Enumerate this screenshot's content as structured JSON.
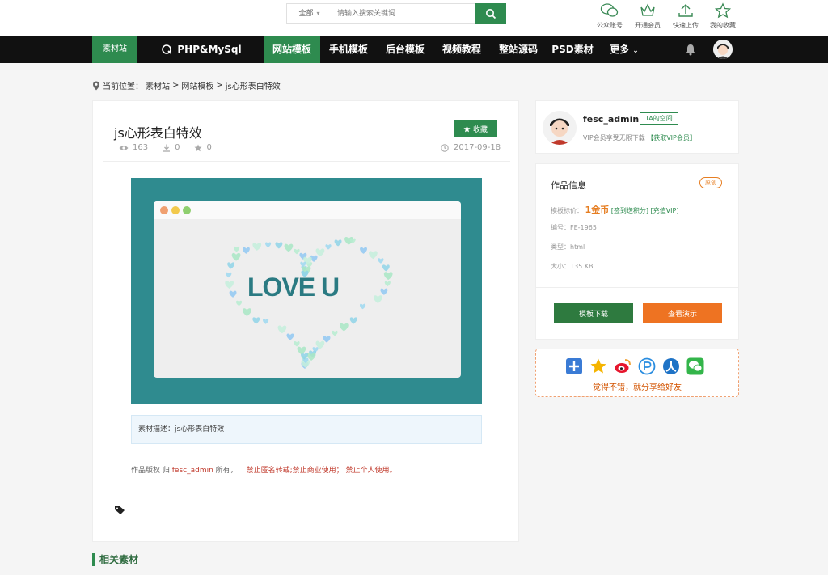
{
  "search": {
    "scope": "全部",
    "placeholder": "请输入搜索关键词"
  },
  "quick_links": [
    {
      "label": "公众账号",
      "icon": "wechat-icon"
    },
    {
      "label": "开通会员",
      "icon": "crown-icon"
    },
    {
      "label": "快速上传",
      "icon": "upload-icon"
    },
    {
      "label": "我的收藏",
      "icon": "star-icon"
    }
  ],
  "nav": {
    "logo": "素材站",
    "items": [
      {
        "label": "PHP&MySql"
      },
      {
        "label": "网站模板"
      },
      {
        "label": "手机模板"
      },
      {
        "label": "后台模板"
      },
      {
        "label": "视频教程"
      },
      {
        "label": "整站源码"
      },
      {
        "label": "PSD素材"
      },
      {
        "label": "更多"
      }
    ]
  },
  "breadcrumb": {
    "prefix": "当前位置：",
    "items": [
      "素材站",
      "网站模板",
      "js心形表白特效"
    ],
    "sep": ">"
  },
  "work": {
    "title": "js心形表白特效",
    "fav_label": "收藏",
    "views": "163",
    "downloads": "0",
    "stars": "0",
    "date": "2017-09-18",
    "preview_text": "LOVE U",
    "desc_label": "素材描述：",
    "desc": "js心形表白特效",
    "copyright_prefix": "作品版权 归",
    "copyright_user": "fesc_admin",
    "copyright_suffix": "所有，",
    "copyright_warning": "禁止匿名转载;禁止商业使用；  禁止个人使用。"
  },
  "related_title": "相关素材",
  "author": {
    "name": "fesc_admin",
    "space_label": "TA的空间",
    "vip_text": "VIP会员享受无限下载",
    "vip_link": "【获取VIP会员】"
  },
  "info": {
    "heading": "作品信息",
    "badge": "原创",
    "price_label": "模板标价：",
    "price_value": "1金币",
    "price_link1": "[签到送积分]",
    "price_link2": "[充值VIP]",
    "id_label": "编号：",
    "id_value": "FE-1965",
    "type_label": "类型：",
    "type_value": "html",
    "size_label": "大小：",
    "size_value": "135 KB",
    "download_label": "模板下载",
    "demo_label": "查看演示"
  },
  "share": {
    "text": "觉得不错，就分享给好友"
  },
  "colors": {
    "accent": "#2e8b4f",
    "orange": "#ee7322",
    "preview_bg": "#2f8b8f"
  }
}
